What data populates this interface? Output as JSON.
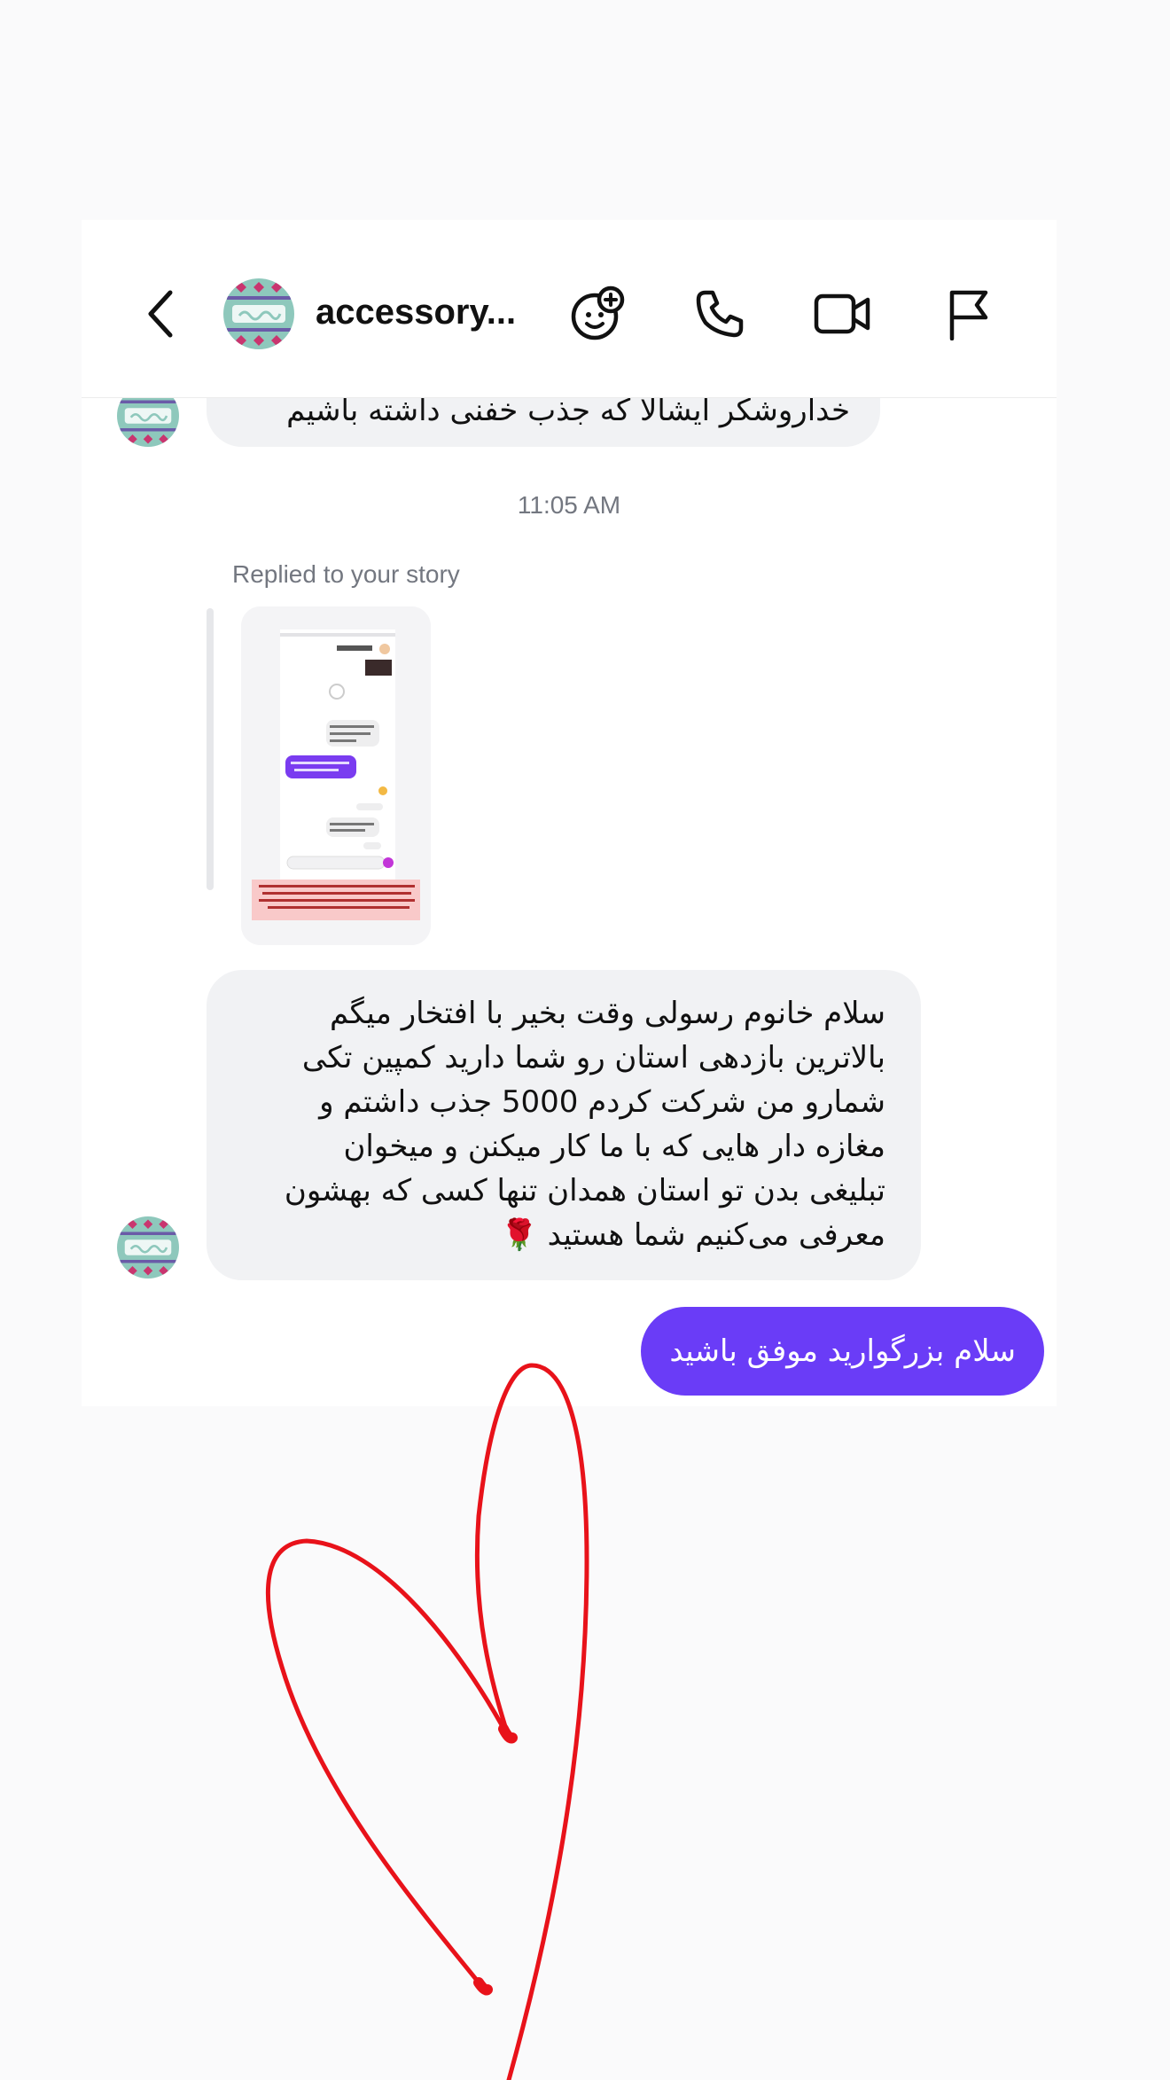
{
  "header": {
    "name": "accessory...",
    "icons": {
      "back": "chevron-left-icon",
      "effects": "sticker-plus-icon",
      "call": "phone-icon",
      "video": "video-camera-icon",
      "report": "flag-icon"
    }
  },
  "messages": {
    "incoming_partial": "خداروشکر ایشالا که جذب خفنی داشته باشیم",
    "timestamp": "11:05 AM",
    "replied_label": "Replied to your story",
    "incoming_main_lines": [
      "سلام خانوم رسولی وقت بخیر با افتخار میگم",
      "بالاترین بازدهی استان رو شما دارید کمپین تکی",
      "شمارو من شرکت کردم 5000 جذب داشتم و",
      "مغازه دار هایی که با ما کار میکنن و میخوان",
      "تبلیغی بدن تو استان همدان تنها کسی که بهشون",
      "معرفی می‌کنیم شما هستید 🌹"
    ],
    "outgoing": "سلام بزرگوارید موفق باشید"
  },
  "colors": {
    "outgoing_bubble": "#6a3cf7",
    "incoming_bubble": "#f1f2f4",
    "heart_stroke": "#e8121a",
    "secondary_text": "#737780"
  }
}
